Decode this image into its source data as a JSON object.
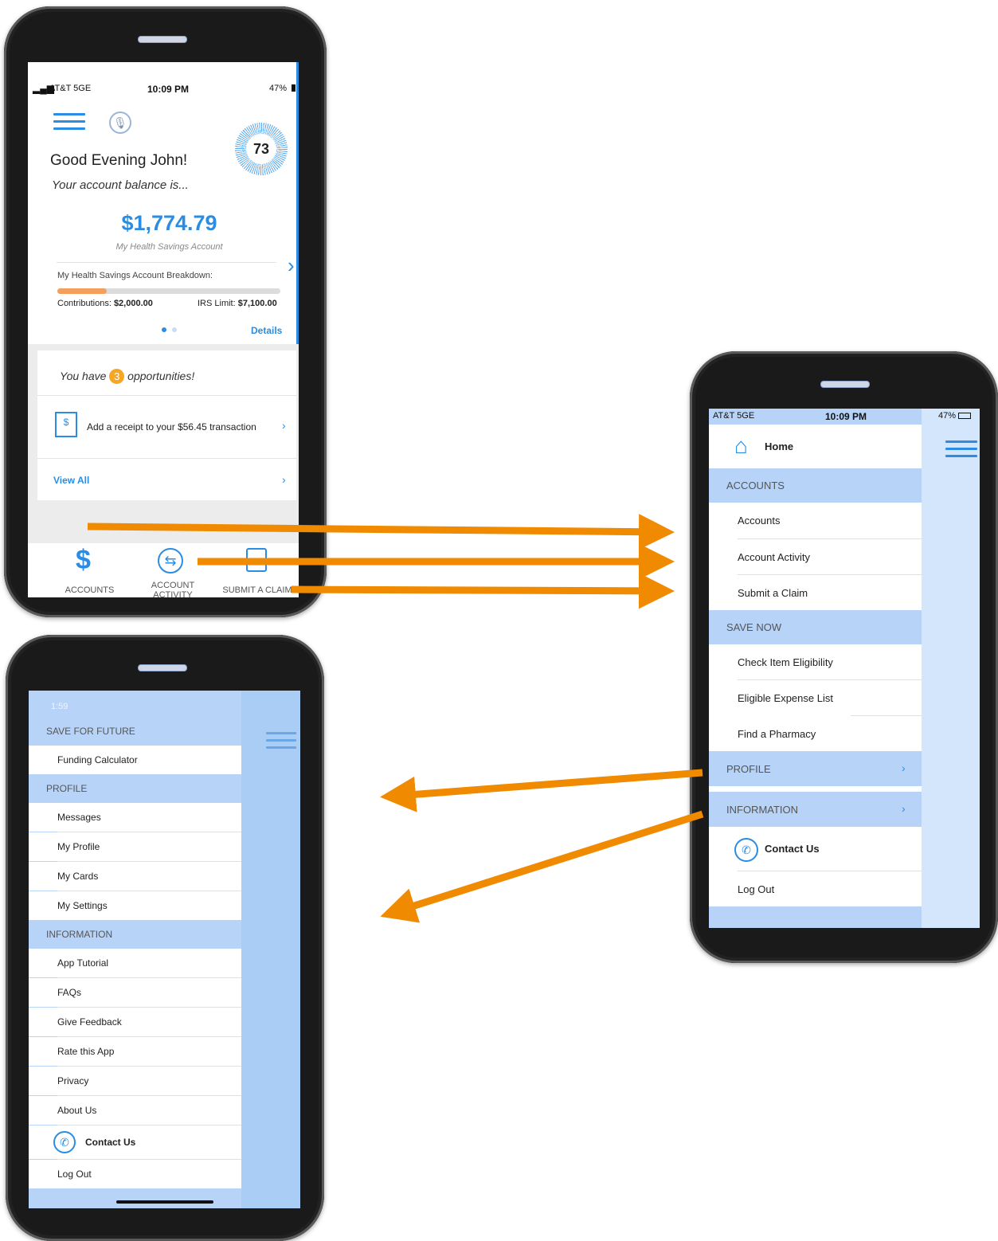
{
  "phone1": {
    "status": {
      "carrier": "AT&T 5GE",
      "time": "10:09 PM",
      "battery": "47%"
    },
    "score": "73",
    "greeting": "Good Evening John!",
    "balance_intro": "Your account balance is...",
    "balance": "$1,774.79",
    "account_name": "My Health Savings Account",
    "breakdown_label": "My Health Savings Account Breakdown:",
    "contributions_label": "Contributions:",
    "contributions_value": "$2,000.00",
    "irs_label": "IRS Limit:",
    "irs_value": "$7,100.00",
    "contribution_progress": 0.22,
    "details_link": "Details",
    "opportunities_prefix": "You have",
    "opportunities_count": "3",
    "opportunities_suffix": "opportunities!",
    "receipt_text": "Add a receipt to your $56.45 transaction",
    "view_all": "View All",
    "tabs": [
      {
        "label": "ACCOUNTS",
        "icon": "dollar-icon"
      },
      {
        "label": "ACCOUNT\nACTIVITY",
        "icon": "exchange-icon"
      },
      {
        "label": "SUBMIT A CLAIM",
        "icon": "clipboard-icon"
      }
    ]
  },
  "phone2": {
    "status": {
      "carrier": "AT&T 5GE",
      "time": "10:09 PM",
      "battery": "47%"
    },
    "home": "Home",
    "sections": {
      "accounts": "ACCOUNTS",
      "save_now": "SAVE NOW",
      "profile": "PROFILE",
      "information": "INFORMATION"
    },
    "items": {
      "accounts": "Accounts",
      "account_activity": "Account Activity",
      "submit_claim": "Submit a Claim",
      "check_eligibility": "Check Item Eligibility",
      "eligible_list": "Eligible Expense List",
      "find_pharmacy": "Find a Pharmacy",
      "contact_us": "Contact Us",
      "log_out": "Log Out"
    }
  },
  "phone3": {
    "status": {
      "time": "1:59"
    },
    "sections": {
      "save_future": "SAVE FOR FUTURE",
      "profile": "PROFILE",
      "information": "INFORMATION"
    },
    "items": {
      "funding_calculator": "Funding Calculator",
      "messages": "Messages",
      "my_profile": "My Profile",
      "my_cards": "My Cards",
      "my_settings": "My Settings",
      "app_tutorial": "App Tutorial",
      "faqs": "FAQs",
      "give_feedback": "Give Feedback",
      "rate_app": "Rate this App",
      "privacy": "Privacy",
      "about_us": "About Us",
      "contact_us": "Contact Us",
      "log_out": "Log Out"
    }
  },
  "colors": {
    "accent": "#2a8de3",
    "arrow": "#f08a00",
    "menu_header": "#b7d4f8",
    "badge": "#f5a623"
  }
}
